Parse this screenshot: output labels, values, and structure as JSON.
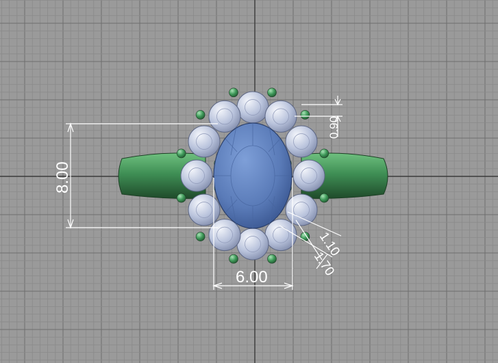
{
  "viewport": {
    "background": "#9a9a9a",
    "grid_minor_color": "#8a8a8a",
    "grid_major_color": "#6e6e6e",
    "axis_color": "#3a3a3a"
  },
  "model": {
    "band_color": "#3f8f55",
    "center_stone_color": "#5a7bb8",
    "halo_stone_color": "#b9c3dc",
    "prong_color": "#3f9a5a"
  },
  "dimensions": {
    "height": "8.00",
    "width": "6.00",
    "gap": "0.90",
    "halo_offset": "1.10",
    "halo_inner": "1.70"
  },
  "dimension_color": "#ffffff"
}
